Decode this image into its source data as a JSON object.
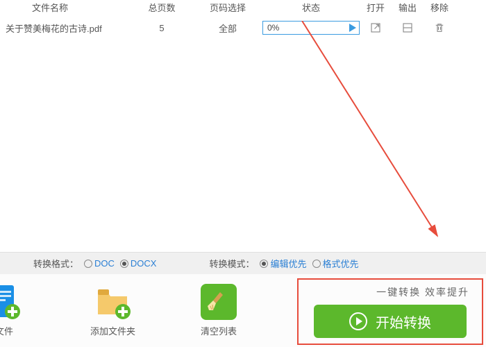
{
  "headers": {
    "name": "文件名称",
    "pages": "总页数",
    "select": "页码选择",
    "status": "状态",
    "open": "打开",
    "output": "输出",
    "remove": "移除"
  },
  "row": {
    "filename": "关于赞美梅花的古诗.pdf",
    "pages": "5",
    "select": "全部",
    "progress": "0%"
  },
  "options": {
    "formatLabel": "转换格式：",
    "doc": "DOC",
    "docx": "DOCX",
    "modeLabel": "转换模式：",
    "editFirst": "编辑优先",
    "layoutFirst": "格式优先"
  },
  "actions": {
    "file": "文件",
    "addFolder": "添加文件夹",
    "clearList": "清空列表"
  },
  "convert": {
    "hint": "一键转换 效率提升",
    "button": "开始转换"
  }
}
